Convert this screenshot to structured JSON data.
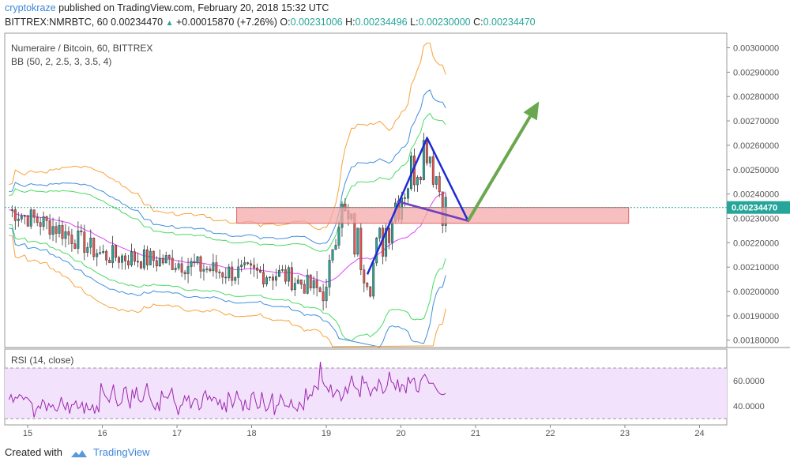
{
  "header": {
    "author": "cryptokraze",
    "published_text": "published on TradingView.com, February 20, 2018 15:32 UTC",
    "symbol_line": "BITTREX:NMRBTC, 60",
    "last_price": "0.00234470",
    "change": "+0.00015870 (+7.26%)",
    "o_label": "O:",
    "o_value": "0.00231006",
    "h_label": "H:",
    "h_value": "0.00234496",
    "l_label": "L:",
    "l_value": "0.00230000",
    "c_label": "C:",
    "c_value": "0.00234470"
  },
  "footer": {
    "created_with": "Created with",
    "brand": "TradingView"
  },
  "colors": {
    "bull": "#26a69a",
    "bear": "#ef5350",
    "upper_band": "#f7a23b",
    "mid_band": "#e040fb",
    "inner_upper": "#3f8fe0",
    "inner_lower": "#4cd964",
    "zone_fill": "#f4a9a9",
    "zone_border": "#e06363",
    "rsi_line": "#9c27b0",
    "rsi_band_fill": "#f3e2fb",
    "triangle": "#1e2bd6",
    "arrow": "#6aa84f",
    "axis": "#555555"
  },
  "chart_data": [
    {
      "type": "candlestick",
      "title": "Numeraire / Bitcoin, 60, BITTREX",
      "indicator_label": "BB (50, 2, 2.5, 3, 3.5, 4)",
      "price_axis_ticks": [
        "0.00300000",
        "0.00290000",
        "0.00280000",
        "0.00270000",
        "0.00260000",
        "0.00250000",
        "0.00240000",
        "0.00230000",
        "0.00220000",
        "0.00210000",
        "0.00200000",
        "0.00190000",
        "0.00180000"
      ],
      "ylim": [
        0.00177,
        0.00306
      ],
      "time_axis_ticks": [
        "15",
        "16",
        "17",
        "18",
        "19",
        "20",
        "21",
        "22",
        "23",
        "24"
      ],
      "current_price_label": "0.00234470",
      "close_path_key_points": [
        {
          "x": 14.75,
          "y": 0.002335
        },
        {
          "x": 15.4,
          "y": 0.00226
        },
        {
          "x": 16.0,
          "y": 0.00215
        },
        {
          "x": 17.0,
          "y": 0.00212
        },
        {
          "x": 17.6,
          "y": 0.00208
        },
        {
          "x": 18.4,
          "y": 0.00207
        },
        {
          "x": 19.0,
          "y": 0.00199
        },
        {
          "x": 19.15,
          "y": 0.00235
        },
        {
          "x": 19.6,
          "y": 0.00208
        },
        {
          "x": 19.9,
          "y": 0.00235
        },
        {
          "x": 20.35,
          "y": 0.00262
        },
        {
          "x": 20.6,
          "y": 0.00233
        }
      ],
      "support_zone": {
        "x_start": 17.8,
        "x_end": 23.05,
        "y_low": 0.00228,
        "y_high": 0.002345
      },
      "triangle": [
        {
          "x": 19.55,
          "y": 0.00207
        },
        {
          "x": 20.35,
          "y": 0.00263
        },
        {
          "x": 20.9,
          "y": 0.00229
        },
        {
          "x": 19.95,
          "y": 0.00237
        }
      ],
      "projection_arrow": [
        {
          "x": 20.9,
          "y": 0.00229
        },
        {
          "x": 21.85,
          "y": 0.00278
        }
      ]
    },
    {
      "type": "line",
      "indicator_label": "RSI (14, close)",
      "ylim": [
        25,
        85
      ],
      "ticks": [
        "60.0000",
        "40.0000"
      ],
      "bands": [
        70,
        30
      ],
      "series": [
        {
          "x_start": 14.75,
          "x_end": 20.6,
          "values": [
            45,
            49,
            43,
            47,
            46,
            49,
            48,
            45,
            47,
            46,
            44,
            42,
            31,
            37,
            40,
            38,
            45,
            43,
            36,
            42,
            39,
            41,
            37,
            36,
            40,
            47,
            41,
            37,
            43,
            34,
            41,
            41,
            44,
            38,
            39,
            43,
            34,
            42,
            37,
            37,
            41,
            34,
            40,
            35,
            58,
            52,
            48,
            46,
            43,
            50,
            57,
            46,
            40,
            41,
            43,
            54,
            55,
            45,
            38,
            53,
            46,
            55,
            45,
            43,
            44,
            51,
            58,
            49,
            44,
            40,
            37,
            43,
            36,
            52,
            47,
            47,
            46,
            50,
            54,
            44,
            40,
            33,
            40,
            41,
            48,
            44,
            48,
            38,
            43,
            46,
            45,
            37,
            39,
            49,
            52,
            45,
            48,
            44,
            47,
            46,
            41,
            45,
            37,
            43,
            35,
            51,
            46,
            39,
            44,
            52,
            46,
            44,
            36,
            45,
            38,
            37,
            49,
            51,
            44,
            38,
            39,
            51,
            42,
            36,
            38,
            43,
            50,
            33,
            40,
            41,
            49,
            45,
            40,
            40,
            39,
            45,
            39,
            38,
            36,
            43,
            40,
            37,
            54,
            45,
            49,
            48,
            56,
            55,
            53,
            75,
            60,
            56,
            55,
            51,
            57,
            47,
            50,
            53,
            51,
            44,
            48,
            55,
            50,
            57,
            64,
            56,
            54,
            53,
            47,
            64,
            58,
            59,
            54,
            48,
            53,
            55,
            52,
            61,
            57,
            50,
            52,
            56,
            67,
            59,
            58,
            53,
            61,
            51,
            57,
            56,
            50,
            63,
            58,
            61,
            62,
            52,
            51,
            60,
            63,
            65,
            62,
            58,
            58,
            58,
            55,
            52,
            50,
            49,
            49,
            50
          ]
        }
      ]
    }
  ]
}
